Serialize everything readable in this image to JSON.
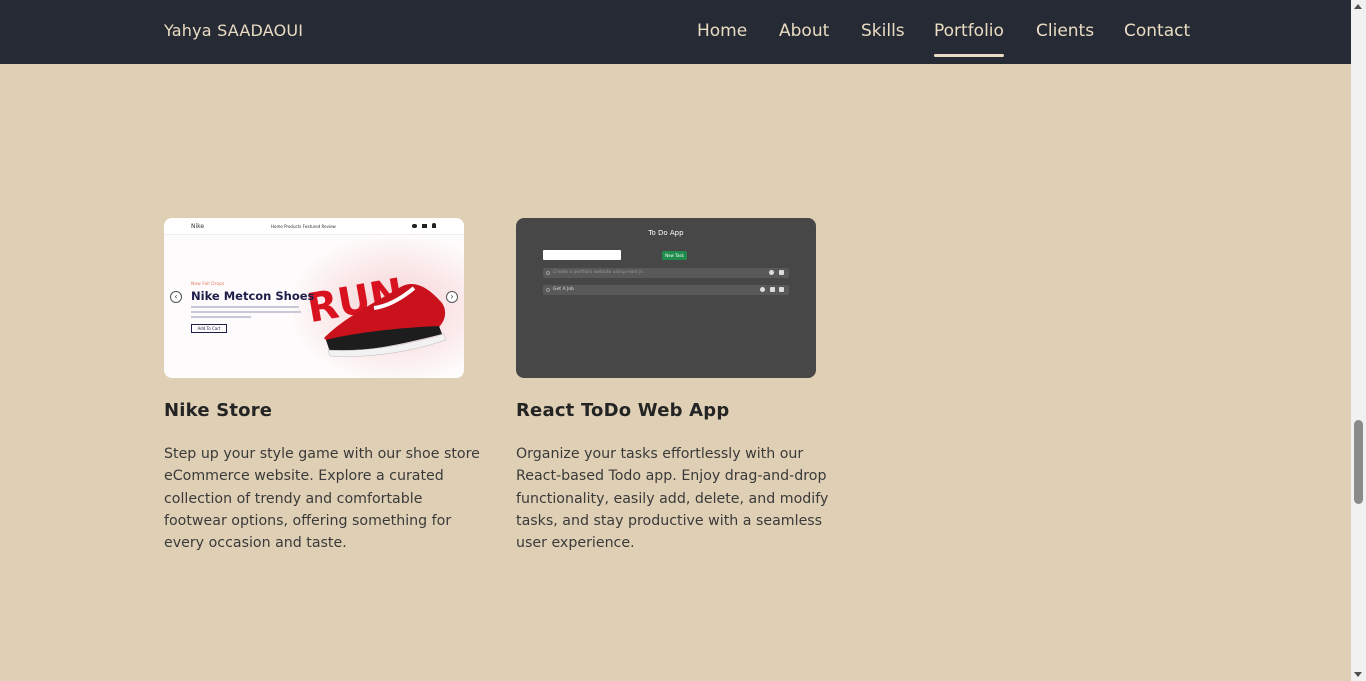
{
  "header": {
    "brand": "Yahya SAADAOUI",
    "nav": [
      {
        "label": "Home"
      },
      {
        "label": "About"
      },
      {
        "label": "Skills"
      },
      {
        "label": "Portfolio",
        "active": true
      },
      {
        "label": "Clients"
      },
      {
        "label": "Contact"
      }
    ]
  },
  "portfolio": {
    "cards": [
      {
        "title": "Nike Store",
        "description": "Step up your style game with our shoe store eCommerce website. Explore a curated collection of trendy and comfortable footwear options, offering something for every occasion and taste.",
        "thumbnail": {
          "brand": "Nike",
          "menu": "Home   Products   Featured   Review",
          "tag": "New Fall Drops",
          "headline": "Nike Metcon Shoes",
          "cta": "Add To Cart",
          "prev_icon": "‹",
          "next_icon": "›"
        }
      },
      {
        "title": "React ToDo Web App",
        "description": "Organize your tasks effortlessly with our React-based Todo app. Enjoy drag-and-drop functionality, easily add, delete, and modify tasks, and stay productive with a seamless user experience.",
        "thumbnail": {
          "title": "To Do App",
          "button": "New Task",
          "task1": "Create a portfolio website using react js",
          "task2": "Get A Job"
        }
      }
    ]
  },
  "colors": {
    "page_bg": "#dfd0b5",
    "header_bg": "#252a35",
    "header_text": "#eadcc2"
  }
}
